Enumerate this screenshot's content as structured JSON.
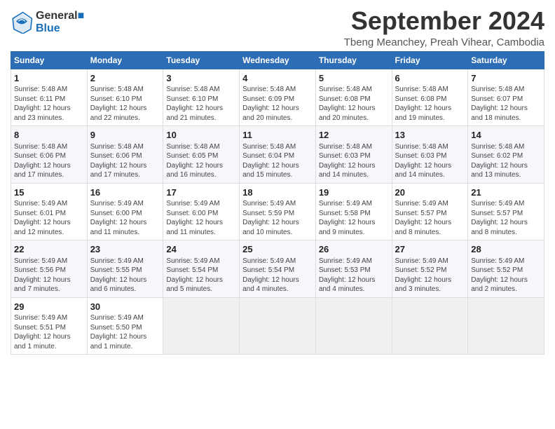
{
  "header": {
    "logo_line1": "General",
    "logo_line2": "Blue",
    "month": "September 2024",
    "location": "Tbeng Meanchey, Preah Vihear, Cambodia"
  },
  "weekdays": [
    "Sunday",
    "Monday",
    "Tuesday",
    "Wednesday",
    "Thursday",
    "Friday",
    "Saturday"
  ],
  "weeks": [
    [
      {
        "day": "1",
        "info": "Sunrise: 5:48 AM\nSunset: 6:11 PM\nDaylight: 12 hours\nand 23 minutes."
      },
      {
        "day": "2",
        "info": "Sunrise: 5:48 AM\nSunset: 6:10 PM\nDaylight: 12 hours\nand 22 minutes."
      },
      {
        "day": "3",
        "info": "Sunrise: 5:48 AM\nSunset: 6:10 PM\nDaylight: 12 hours\nand 21 minutes."
      },
      {
        "day": "4",
        "info": "Sunrise: 5:48 AM\nSunset: 6:09 PM\nDaylight: 12 hours\nand 20 minutes."
      },
      {
        "day": "5",
        "info": "Sunrise: 5:48 AM\nSunset: 6:08 PM\nDaylight: 12 hours\nand 20 minutes."
      },
      {
        "day": "6",
        "info": "Sunrise: 5:48 AM\nSunset: 6:08 PM\nDaylight: 12 hours\nand 19 minutes."
      },
      {
        "day": "7",
        "info": "Sunrise: 5:48 AM\nSunset: 6:07 PM\nDaylight: 12 hours\nand 18 minutes."
      }
    ],
    [
      {
        "day": "8",
        "info": "Sunrise: 5:48 AM\nSunset: 6:06 PM\nDaylight: 12 hours\nand 17 minutes."
      },
      {
        "day": "9",
        "info": "Sunrise: 5:48 AM\nSunset: 6:06 PM\nDaylight: 12 hours\nand 17 minutes."
      },
      {
        "day": "10",
        "info": "Sunrise: 5:48 AM\nSunset: 6:05 PM\nDaylight: 12 hours\nand 16 minutes."
      },
      {
        "day": "11",
        "info": "Sunrise: 5:48 AM\nSunset: 6:04 PM\nDaylight: 12 hours\nand 15 minutes."
      },
      {
        "day": "12",
        "info": "Sunrise: 5:48 AM\nSunset: 6:03 PM\nDaylight: 12 hours\nand 14 minutes."
      },
      {
        "day": "13",
        "info": "Sunrise: 5:48 AM\nSunset: 6:03 PM\nDaylight: 12 hours\nand 14 minutes."
      },
      {
        "day": "14",
        "info": "Sunrise: 5:48 AM\nSunset: 6:02 PM\nDaylight: 12 hours\nand 13 minutes."
      }
    ],
    [
      {
        "day": "15",
        "info": "Sunrise: 5:49 AM\nSunset: 6:01 PM\nDaylight: 12 hours\nand 12 minutes."
      },
      {
        "day": "16",
        "info": "Sunrise: 5:49 AM\nSunset: 6:00 PM\nDaylight: 12 hours\nand 11 minutes."
      },
      {
        "day": "17",
        "info": "Sunrise: 5:49 AM\nSunset: 6:00 PM\nDaylight: 12 hours\nand 11 minutes."
      },
      {
        "day": "18",
        "info": "Sunrise: 5:49 AM\nSunset: 5:59 PM\nDaylight: 12 hours\nand 10 minutes."
      },
      {
        "day": "19",
        "info": "Sunrise: 5:49 AM\nSunset: 5:58 PM\nDaylight: 12 hours\nand 9 minutes."
      },
      {
        "day": "20",
        "info": "Sunrise: 5:49 AM\nSunset: 5:57 PM\nDaylight: 12 hours\nand 8 minutes."
      },
      {
        "day": "21",
        "info": "Sunrise: 5:49 AM\nSunset: 5:57 PM\nDaylight: 12 hours\nand 8 minutes."
      }
    ],
    [
      {
        "day": "22",
        "info": "Sunrise: 5:49 AM\nSunset: 5:56 PM\nDaylight: 12 hours\nand 7 minutes."
      },
      {
        "day": "23",
        "info": "Sunrise: 5:49 AM\nSunset: 5:55 PM\nDaylight: 12 hours\nand 6 minutes."
      },
      {
        "day": "24",
        "info": "Sunrise: 5:49 AM\nSunset: 5:54 PM\nDaylight: 12 hours\nand 5 minutes."
      },
      {
        "day": "25",
        "info": "Sunrise: 5:49 AM\nSunset: 5:54 PM\nDaylight: 12 hours\nand 4 minutes."
      },
      {
        "day": "26",
        "info": "Sunrise: 5:49 AM\nSunset: 5:53 PM\nDaylight: 12 hours\nand 4 minutes."
      },
      {
        "day": "27",
        "info": "Sunrise: 5:49 AM\nSunset: 5:52 PM\nDaylight: 12 hours\nand 3 minutes."
      },
      {
        "day": "28",
        "info": "Sunrise: 5:49 AM\nSunset: 5:52 PM\nDaylight: 12 hours\nand 2 minutes."
      }
    ],
    [
      {
        "day": "29",
        "info": "Sunrise: 5:49 AM\nSunset: 5:51 PM\nDaylight: 12 hours\nand 1 minute."
      },
      {
        "day": "30",
        "info": "Sunrise: 5:49 AM\nSunset: 5:50 PM\nDaylight: 12 hours\nand 1 minute."
      },
      null,
      null,
      null,
      null,
      null
    ]
  ]
}
